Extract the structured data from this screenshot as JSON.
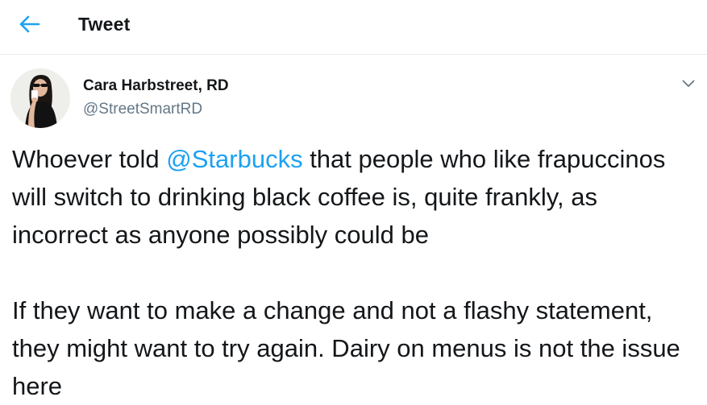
{
  "header": {
    "back_icon": "arrow-left-icon",
    "title": "Tweet"
  },
  "tweet": {
    "author": {
      "avatar_icon": "profile-photo",
      "display_name": "Cara Harbstreet, RD",
      "handle": "@StreetSmartRD"
    },
    "more_icon": "chevron-down-icon",
    "paragraph1": {
      "before_mention": "Whoever told ",
      "mention": "@Starbucks",
      "after_mention": " that people who like frapuccinos will switch to drinking black coffee is, quite frankly, as incorrect as anyone possibly could be"
    },
    "paragraph2": "If they want to make a change and not a flashy statement, they might want to try again. Dairy on menus is not the issue here"
  },
  "colors": {
    "accent": "#1da1f2",
    "text_primary": "#14171a",
    "text_secondary": "#657786",
    "divider": "#e6ecf0"
  }
}
